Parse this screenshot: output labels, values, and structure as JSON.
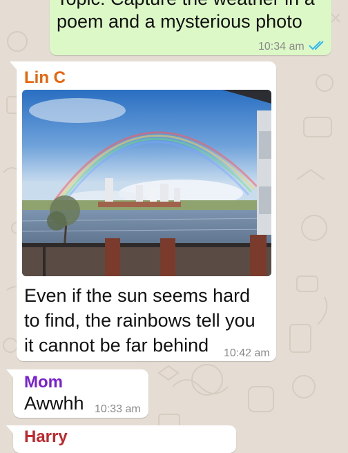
{
  "colors": {
    "wallpaper": "#e5ddd4",
    "outgoing_bubble": "#dcf8c6",
    "incoming_bubble": "#ffffff",
    "read_ticks": "#34b7f1",
    "sender_lin": "#e8630a",
    "sender_mom": "#7a1fd1",
    "sender_harry": "#c0262b"
  },
  "messages": [
    {
      "direction": "outgoing",
      "lines": [
        "Topic: Capture the weather in a",
        "poem and a mysterious photo"
      ],
      "time": "10:34 am",
      "status_icon": "double-check-read-icon"
    },
    {
      "direction": "incoming",
      "sender": "Lin C",
      "image": "rainbow-over-river-photo",
      "lines": [
        "Even if the sun seems hard",
        "to find, the rainbows tell you",
        "it cannot be far behind"
      ],
      "time": "10:42 am"
    },
    {
      "direction": "incoming",
      "sender": "Mom",
      "lines": [
        "Awwhh"
      ],
      "time": "10:33 am"
    },
    {
      "direction": "incoming",
      "sender": "Harry",
      "lines": []
    }
  ]
}
